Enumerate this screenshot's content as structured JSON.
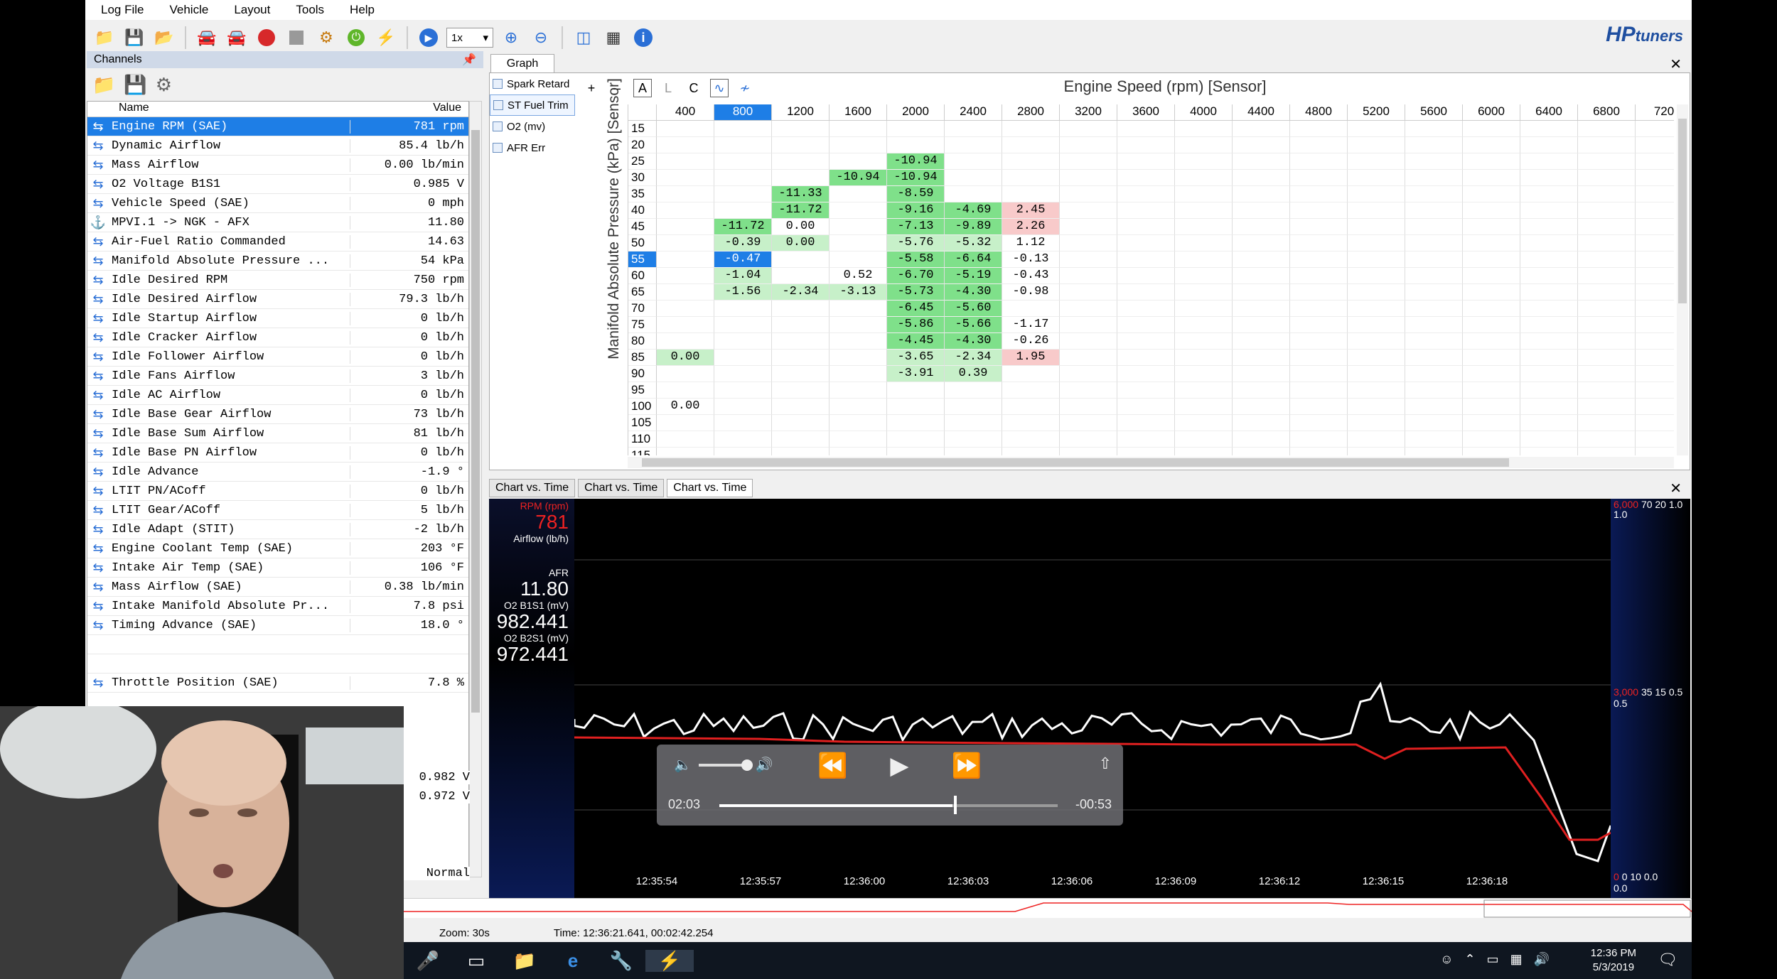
{
  "menu": {
    "items": [
      "Log File",
      "Vehicle",
      "Layout",
      "Tools",
      "Help"
    ]
  },
  "toolbar": {
    "speed": "1x",
    "brand": "HP",
    "brand_suffix": "tuners"
  },
  "channels": {
    "title": "Channels",
    "col_name": "Name",
    "col_value": "Value",
    "rows": [
      {
        "name": "Engine RPM (SAE)",
        "value": "781 rpm"
      },
      {
        "name": "Dynamic Airflow",
        "value": "85.4 lb/h"
      },
      {
        "name": "Mass Airflow",
        "value": "0.00 lb/min"
      },
      {
        "name": "O2 Voltage B1S1",
        "value": "0.985 V"
      },
      {
        "name": "Vehicle Speed (SAE)",
        "value": "0 mph"
      },
      {
        "name": "MPVI.1 -> NGK - AFX",
        "value": "11.80"
      },
      {
        "name": "Air-Fuel Ratio Commanded",
        "value": "14.63"
      },
      {
        "name": "Manifold Absolute Pressure ...",
        "value": "54 kPa"
      },
      {
        "name": "Idle Desired RPM",
        "value": "750 rpm"
      },
      {
        "name": "Idle Desired Airflow",
        "value": "79.3 lb/h"
      },
      {
        "name": "Idle Startup Airflow",
        "value": "0 lb/h"
      },
      {
        "name": "Idle Cracker Airflow",
        "value": "0 lb/h"
      },
      {
        "name": "Idle Follower Airflow",
        "value": "0 lb/h"
      },
      {
        "name": "Idle Fans Airflow",
        "value": "3 lb/h"
      },
      {
        "name": "Idle AC Airflow",
        "value": "0 lb/h"
      },
      {
        "name": "Idle Base Gear Airflow",
        "value": "73 lb/h"
      },
      {
        "name": "Idle Base Sum Airflow",
        "value": "81 lb/h"
      },
      {
        "name": "Idle Base PN Airflow",
        "value": "0 lb/h"
      },
      {
        "name": "Idle Advance",
        "value": "-1.9 °"
      },
      {
        "name": "LTIT PN/ACoff",
        "value": "0 lb/h"
      },
      {
        "name": "LTIT Gear/ACoff",
        "value": "5 lb/h"
      },
      {
        "name": "Idle Adapt (STIT)",
        "value": "-2 lb/h"
      },
      {
        "name": "Engine Coolant Temp (SAE)",
        "value": "203 °F"
      },
      {
        "name": "Intake Air Temp (SAE)",
        "value": "106 °F"
      },
      {
        "name": "Mass Airflow (SAE)",
        "value": "0.38 lb/min"
      },
      {
        "name": "Intake Manifold Absolute Pr...",
        "value": "7.8 psi"
      },
      {
        "name": "Timing Advance (SAE)",
        "value": "18.0 °"
      },
      {
        "name": "",
        "value": ""
      },
      {
        "name": "",
        "value": ""
      },
      {
        "name": "Throttle Position (SAE)",
        "value": "7.8 %"
      }
    ],
    "lower_values": [
      "0.982 V",
      "0.972 V",
      "Normal"
    ]
  },
  "graph": {
    "tab": "Graph",
    "tables": [
      "Spark Retard",
      "ST Fuel Trim",
      "O2 (mv)",
      "AFR Err"
    ],
    "tools": [
      "+",
      "–",
      "A",
      "L",
      "C"
    ],
    "x_title": "Engine Speed (rpm) [Sensor]",
    "y_title": "Manifold Absolute Pressure (kPa) [Sensor]",
    "cols": [
      "400",
      "800",
      "1200",
      "1600",
      "2000",
      "2400",
      "2800",
      "3200",
      "3600",
      "4000",
      "4400",
      "4800",
      "5200",
      "5600",
      "6000",
      "6400",
      "6800",
      "720"
    ],
    "rows": [
      "15",
      "20",
      "25",
      "30",
      "35",
      "40",
      "45",
      "50",
      "55",
      "60",
      "65",
      "70",
      "75",
      "80",
      "85",
      "90",
      "95",
      "100",
      "105",
      "110",
      "115"
    ],
    "cells": [
      [
        "",
        "",
        "",
        "",
        "",
        "",
        ""
      ],
      [
        "",
        "",
        "",
        "",
        "",
        "",
        ""
      ],
      [
        "",
        "",
        "",
        "",
        "-10.94",
        "",
        ""
      ],
      [
        "",
        "",
        "",
        "-10.94",
        "-10.94",
        "",
        ""
      ],
      [
        "",
        "",
        "-11.33",
        "",
        "-8.59",
        "",
        ""
      ],
      [
        "",
        "",
        "-11.72",
        "",
        "-9.16",
        "-4.69",
        "2.45"
      ],
      [
        "",
        "-11.72",
        "0.00",
        "",
        "-7.13",
        "-9.89",
        "2.26"
      ],
      [
        "",
        "-0.39",
        "0.00",
        "",
        "-5.76",
        "-5.32",
        "1.12"
      ],
      [
        "",
        "-0.47",
        "",
        "",
        "-5.58",
        "-6.64",
        "-0.13"
      ],
      [
        "",
        "-1.04",
        "",
        "0.52",
        "-6.70",
        "-5.19",
        "-0.43"
      ],
      [
        "",
        "-1.56",
        "-2.34",
        "-3.13",
        "-5.73",
        "-4.30",
        "-0.98"
      ],
      [
        "",
        "",
        "",
        "",
        "-6.45",
        "-5.60",
        ""
      ],
      [
        "",
        "",
        "",
        "",
        "-5.86",
        "-5.66",
        "-1.17"
      ],
      [
        "",
        "",
        "",
        "",
        "-4.45",
        "-4.30",
        "-0.26"
      ],
      [
        "0.00",
        "",
        "",
        "",
        "-3.65",
        "-2.34",
        "1.95"
      ],
      [
        "",
        "",
        "",
        "",
        "-3.91",
        "0.39",
        ""
      ],
      [
        "",
        "",
        "",
        "",
        "",
        "",
        ""
      ],
      [
        "0.00",
        "",
        "",
        "",
        "",
        "",
        ""
      ],
      [
        "",
        "",
        "",
        "",
        "",
        "",
        ""
      ],
      [
        "",
        "",
        "",
        "",
        "",
        "",
        ""
      ],
      [
        "",
        "",
        "",
        "",
        "",
        "",
        ""
      ]
    ]
  },
  "chart": {
    "tabs": [
      "Chart vs. Time",
      "Chart vs. Time",
      "Chart vs. Time"
    ],
    "left": {
      "rpm_label": "RPM (rpm)",
      "rpm_value": "781",
      "airflow_label": "Airflow (lb/h)",
      "afr_label": "AFR",
      "afr_value": "11.80",
      "o2b1_label": "O2 B1S1 (mV)",
      "o2b1_value": "982.441",
      "o2b2_label": "O2 B2S1 (mV)",
      "o2b2_value": "972.441"
    },
    "right": {
      "top_red": "6,000",
      "top": "70 20 1.0",
      "top2": "1.0",
      "mid_red": "3,000",
      "mid": "35 15 0.5",
      "mid2": "0.5",
      "bot_red": "0",
      "bot": "0 10 0.0",
      "bot2": "0.0"
    },
    "times": [
      "12:35:54",
      "12:35:57",
      "12:36:00",
      "12:36:03",
      "12:36:06",
      "12:36:09",
      "12:36:12",
      "12:36:15",
      "12:36:18"
    ],
    "colors": {
      "rpm": "#e02020",
      "afr": "#ffffff"
    }
  },
  "player": {
    "current": "02:03",
    "remaining": "-00:53",
    "progress": 0.69
  },
  "status": {
    "zoom": "Zoom: 30s",
    "time": "Time: 12:36:21.641, 00:02:42.254"
  },
  "taskbar": {
    "time": "12:36 PM",
    "date": "5/3/2019"
  }
}
